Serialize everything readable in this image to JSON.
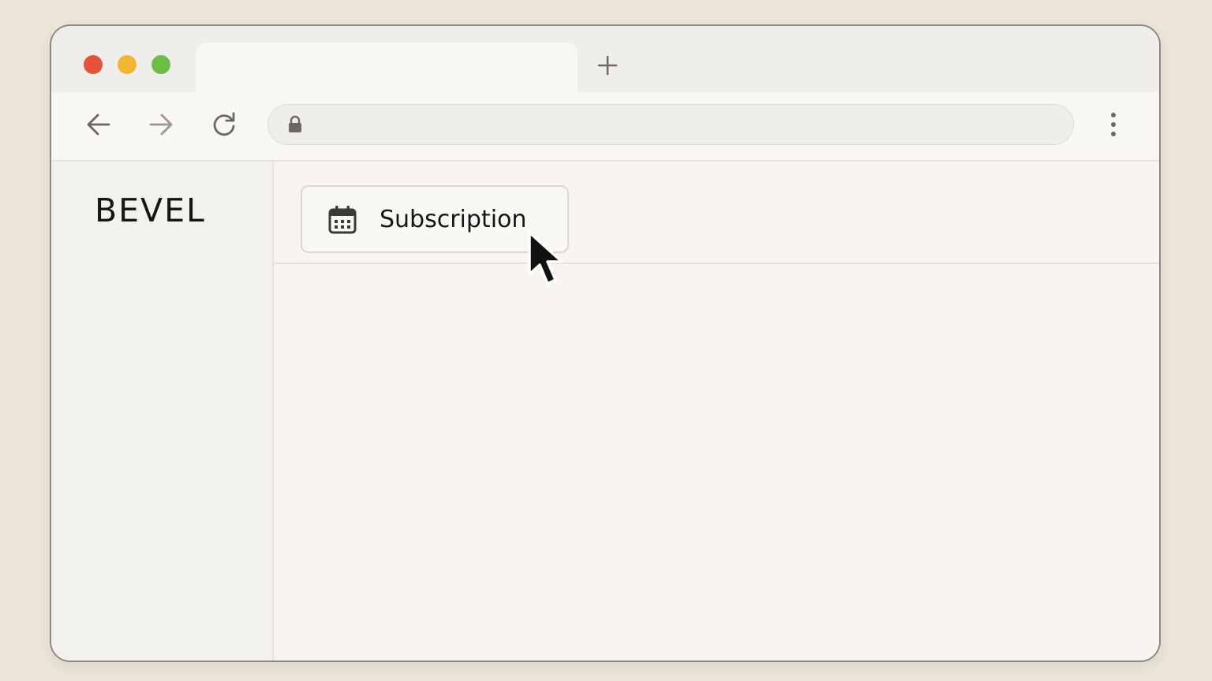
{
  "window": {
    "traffic_lights": {
      "close_color": "#e5533c",
      "minimize_color": "#f2b631",
      "maximize_color": "#6bbe45"
    }
  },
  "tabs": {
    "active_tab_title": "",
    "new_tab_icon": "plus-icon"
  },
  "toolbar": {
    "back_icon": "arrow-left-icon",
    "forward_icon": "arrow-right-icon",
    "reload_icon": "reload-icon",
    "address": {
      "value": "",
      "placeholder": "",
      "lock_icon": "lock-icon"
    },
    "menu_icon": "kebab-menu-icon"
  },
  "sidebar": {
    "logo_text": "BEVEL"
  },
  "main": {
    "subscription_button": {
      "label": "Subscription",
      "icon": "calendar-icon"
    }
  },
  "cursor": {
    "icon": "mouse-pointer-icon"
  }
}
